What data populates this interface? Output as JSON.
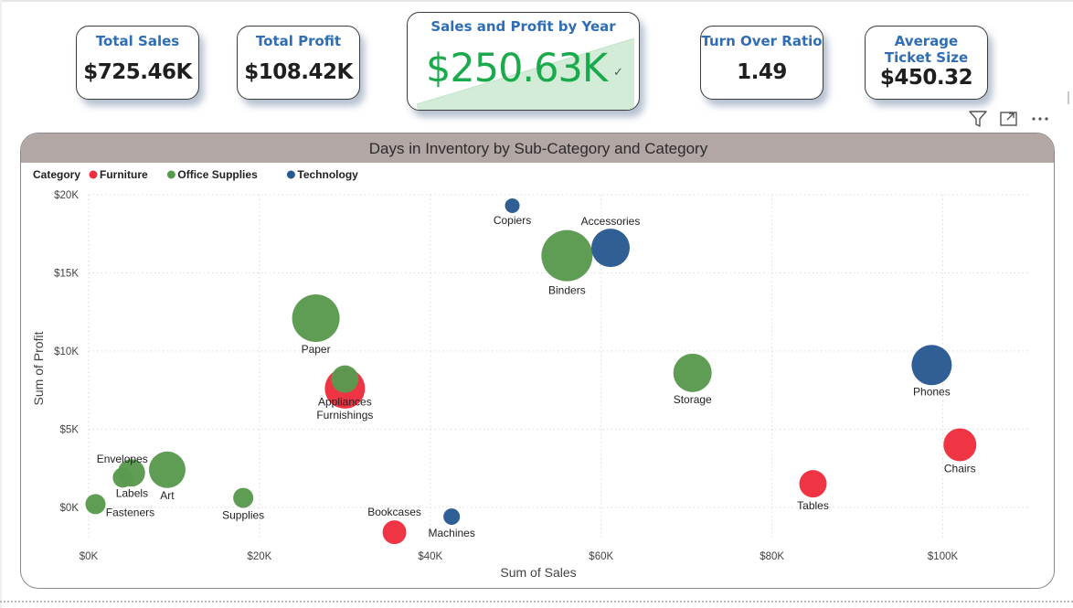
{
  "kpis": {
    "total_sales": {
      "title": "Total Sales",
      "value": "$725.46K"
    },
    "total_profit": {
      "title": "Total Profit",
      "value": "$108.42K"
    },
    "sales_profit_year": {
      "title": "Sales and Profit by Year",
      "value": "$250.63K"
    },
    "turnover_ratio": {
      "title": "Turn Over Ratio",
      "value": "1.49"
    },
    "avg_ticket": {
      "title": "Average Ticket Size",
      "value": "$450.32"
    }
  },
  "toolbar": {
    "filter_icon": "filter-icon",
    "focus_icon": "focus-mode-icon",
    "more_icon": "more-options-icon"
  },
  "colors": {
    "furniture": "#ee2d3e",
    "office_supplies": "#5a9a50",
    "technology": "#285a92",
    "kpi_title": "#2f6db5",
    "kpi_green": "#1aaa4b",
    "header_band": "#b3a7a5"
  },
  "chart_data": {
    "type": "scatter",
    "title": "Days in Inventory by Sub-Category and Category",
    "xlabel": "Sum of Sales",
    "ylabel": "Sum of Profit",
    "xlim": [
      0,
      110000
    ],
    "ylim": [
      -2000,
      20000
    ],
    "x_ticks": [
      0,
      20000,
      40000,
      60000,
      80000,
      100000
    ],
    "x_tick_labels": [
      "$0K",
      "$20K",
      "$40K",
      "$60K",
      "$80K",
      "$100K"
    ],
    "y_ticks": [
      0,
      5000,
      10000,
      15000,
      20000
    ],
    "y_tick_labels": [
      "$0K",
      "$5K",
      "$10K",
      "$15K",
      "$20K"
    ],
    "grid": true,
    "legend_title": "Category",
    "legend_position": "top-left",
    "legend": [
      "Furniture",
      "Office Supplies",
      "Technology"
    ],
    "points": [
      {
        "label": "Copiers",
        "category": "Technology",
        "x": 49600,
        "y": 19300,
        "size": 8
      },
      {
        "label": "Accessories",
        "category": "Technology",
        "x": 61100,
        "y": 16600,
        "size": 21
      },
      {
        "label": "Binders",
        "category": "Office Supplies",
        "x": 56000,
        "y": 16100,
        "size": 28
      },
      {
        "label": "Paper",
        "category": "Office Supplies",
        "x": 26600,
        "y": 12100,
        "size": 26
      },
      {
        "label": "Furnishings",
        "category": "Furniture",
        "x": 30000,
        "y": 7600,
        "size": 22
      },
      {
        "label": "Appliances",
        "category": "Office Supplies",
        "x": 30000,
        "y": 8200,
        "size": 15
      },
      {
        "label": "Storage",
        "category": "Office Supplies",
        "x": 70700,
        "y": 8600,
        "size": 21
      },
      {
        "label": "Phones",
        "category": "Technology",
        "x": 98700,
        "y": 9100,
        "size": 22
      },
      {
        "label": "Chairs",
        "category": "Furniture",
        "x": 102000,
        "y": 4000,
        "size": 18
      },
      {
        "label": "Tables",
        "category": "Furniture",
        "x": 84800,
        "y": 1500,
        "size": 15
      },
      {
        "label": "Envelopes",
        "category": "Office Supplies",
        "x": 5000,
        "y": 2200,
        "size": 15
      },
      {
        "label": "Labels",
        "category": "Office Supplies",
        "x": 4000,
        "y": 1900,
        "size": 11
      },
      {
        "label": "Art",
        "category": "Office Supplies",
        "x": 9200,
        "y": 2400,
        "size": 20
      },
      {
        "label": "Fasteners",
        "category": "Office Supplies",
        "x": 800,
        "y": 200,
        "size": 11
      },
      {
        "label": "Supplies",
        "category": "Office Supplies",
        "x": 18100,
        "y": 600,
        "size": 11
      },
      {
        "label": "Bookcases",
        "category": "Furniture",
        "x": 35800,
        "y": -1600,
        "size": 13
      },
      {
        "label": "Machines",
        "category": "Technology",
        "x": 42500,
        "y": -600,
        "size": 9
      }
    ]
  }
}
